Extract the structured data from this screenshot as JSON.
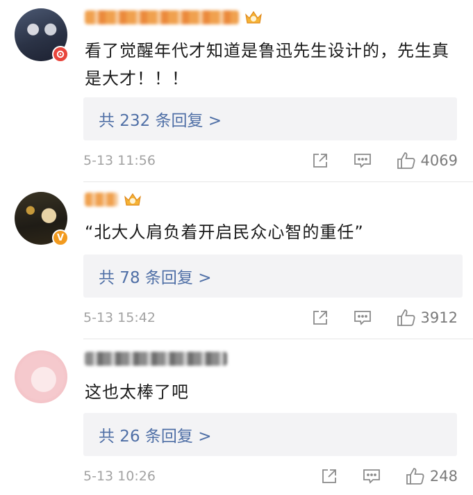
{
  "comments": [
    {
      "text": "看了觉醒年代才知道是鲁迅先生设计的，先生真是大才！！！",
      "replies_label": "共 232 条回复 >",
      "time": "5-13 11:56",
      "likes": "4069"
    },
    {
      "text": "“北大人肩负着开启民众心智的重任”",
      "replies_label": "共 78 条回复 >",
      "time": "5-13 15:42",
      "likes": "3912"
    },
    {
      "text": "这也太棒了吧",
      "replies_label": "共 26 条回复 >",
      "time": "5-13 10:26",
      "likes": "248"
    }
  ],
  "colors": {
    "reply_link": "#4f6fa6",
    "badge_red": "#e8453c",
    "badge_orange": "#f29a1e",
    "crown": "#f0a830"
  }
}
